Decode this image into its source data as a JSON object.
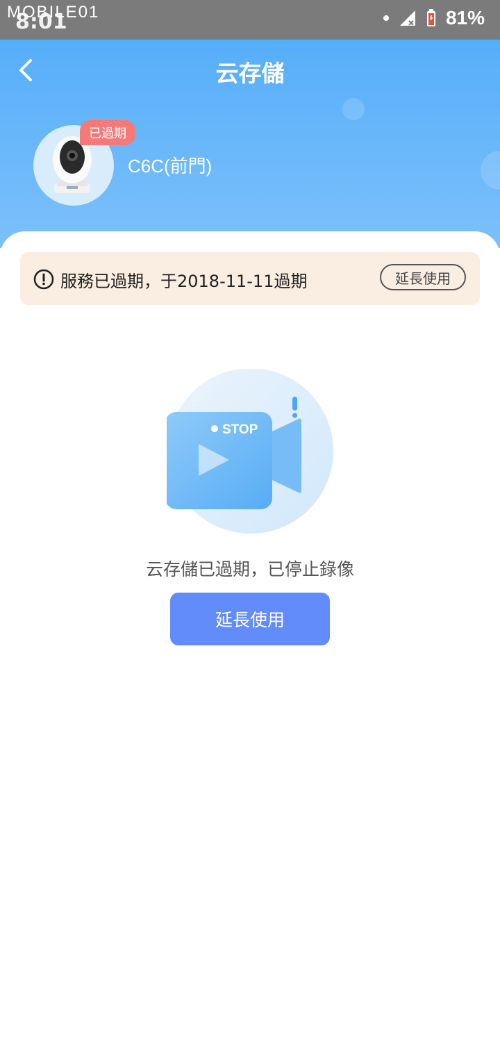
{
  "status_bar": {
    "watermark": "MOBILE01",
    "time": "8:01",
    "battery": "81%"
  },
  "header": {
    "title": "云存儲",
    "expired_badge": "已過期",
    "device_name": "C6C(前門)"
  },
  "notice": {
    "text": "服務已過期，于2018-11-11過期",
    "button_label": "延長使用"
  },
  "illustration": {
    "stop_label": "STOP"
  },
  "main": {
    "message": "云存儲已過期，已停止錄像",
    "button_label": "延長使用"
  },
  "colors": {
    "header_top": "#56aef9",
    "header_bottom": "#7cc0fb",
    "badge": "#f47a7a",
    "notice_bg": "#faede2",
    "primary_button": "#618cf9"
  }
}
